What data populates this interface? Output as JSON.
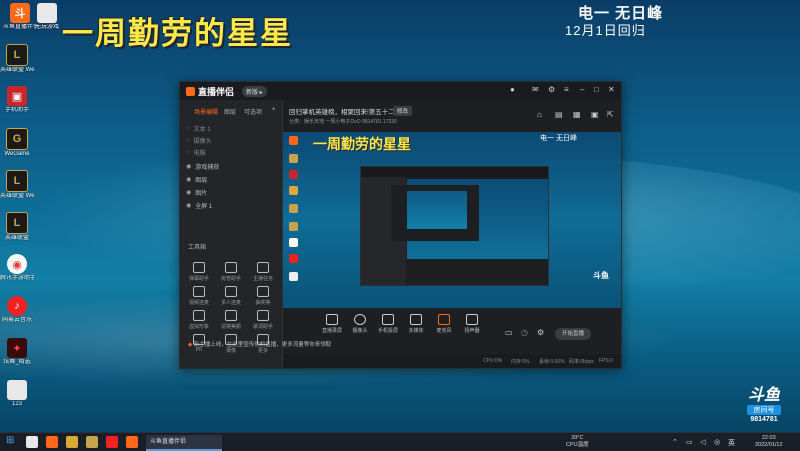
{
  "desktop": {
    "banner": "一周勤劳的星星",
    "top_right_title": "电一 无日峰",
    "top_right_sub": "12月1日回归",
    "icons": [
      {
        "label": "斗鱼直播伴侣",
        "icon": "douyu-companion-icon",
        "color": "#ff6a1a"
      },
      {
        "label": "无玩游戏",
        "icon": "file-icon",
        "color": "#e8e8e8"
      },
      {
        "label": "英雄联盟 WeGame版",
        "icon": "lol-icon",
        "color": "#c7a34c"
      },
      {
        "label": "手机助手",
        "icon": "phone-assistant-icon",
        "color": "#c8262d"
      },
      {
        "label": "WeGame",
        "icon": "wegame-icon",
        "color": "#d9a93a"
      },
      {
        "label": "英雄联盟 WeGame版",
        "icon": "lol-icon",
        "color": "#c7a34c"
      },
      {
        "label": "英雄联盟",
        "icon": "lol-icon",
        "color": "#c7a34c"
      },
      {
        "label": "腾讯手游助手",
        "icon": "tencent-game-icon",
        "color": "#e33"
      },
      {
        "label": "网易云音乐",
        "icon": "netease-music-icon",
        "color": "#e22"
      },
      {
        "label": "炫舞_精选",
        "icon": "game-icon",
        "color": "#b22"
      },
      {
        "label": "123",
        "icon": "file-icon",
        "color": "#e8e8e8"
      }
    ]
  },
  "window": {
    "logo_text": "直播伴侣",
    "version": "新版 ▸",
    "left_tabs": [
      "场景编辑",
      "图层",
      "可选项"
    ],
    "scenes": [
      {
        "name": "文本 1"
      },
      {
        "name": "摄像头"
      },
      {
        "name": "电脑"
      },
      {
        "name": "游戏捕获"
      },
      {
        "name": "图层"
      },
      {
        "name": "图片"
      },
      {
        "name": "全屏 1"
      }
    ],
    "tools_header": "工具箱",
    "tools": [
      "弹幕助手",
      "房管助手",
      "主播任务",
      "视频连麦",
      "多人连麦",
      "抽奖等",
      "虚拟形象",
      "滤镜美颜",
      "歌词助手",
      "PK",
      "录像",
      "更多"
    ],
    "stream_title": "回归掌机英雄榜，相聚回来!第五十二天",
    "stream_tag": "修改",
    "stream_meta": "分类：娱乐天地   一周小电子OvO   9814781   17330",
    "preview_banner": "一周勤劳的星星",
    "preview_tr": "电一 无日峰",
    "controls": [
      "直播录屏",
      "摄像头",
      "手机投屏",
      "多媒体",
      "麦克风",
      "扬声器"
    ],
    "start_button": "开始直播",
    "status_items": [
      "CPU:0%",
      "内存:0%",
      "丢帧:0.00%",
      "码率:0kbps",
      "FPS:0"
    ],
    "notification": "新主播上线，在这里宣传你的直播，更多流量等你来领取"
  },
  "badge": {
    "logo": "斗鱼",
    "room_label": "房间号",
    "room_number": "9814781"
  },
  "taskbar": {
    "active_app": "斗鱼直播伴侣",
    "temp": "39°C",
    "temp_label": "CPU温度",
    "time": "22:03",
    "date": "2022/01/12"
  }
}
